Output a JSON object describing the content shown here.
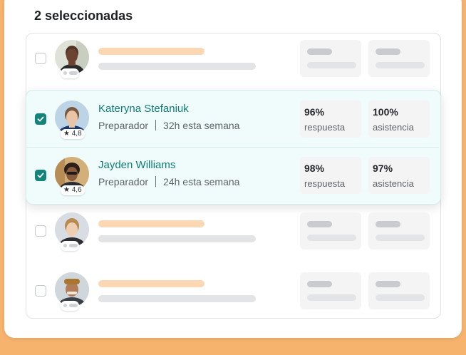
{
  "header": {
    "title": "2 seleccionadas"
  },
  "rows": [
    {
      "selected": false
    },
    {
      "selected": true,
      "name": "Kateryna Stefaniuk",
      "role": "Preparador",
      "hours": "32h esta semana",
      "rating": "4,8",
      "stat1": {
        "value": "96%",
        "label": "respuesta"
      },
      "stat2": {
        "value": "100%",
        "label": "asistencia"
      }
    },
    {
      "selected": true,
      "name": "Jayden Williams",
      "role": "Preparador",
      "hours": "24h esta semana",
      "rating": "4,6",
      "stat1": {
        "value": "98%",
        "label": "respuesta"
      },
      "stat2": {
        "value": "97%",
        "label": "asistencia"
      }
    },
    {
      "selected": false
    },
    {
      "selected": false
    }
  ],
  "colors": {
    "accent": "#12847a",
    "name": "#0f7d73",
    "background": "#f6b36e",
    "selected_bg": "#effcfb"
  },
  "icons": {
    "check": "check-icon",
    "star": "star-icon"
  }
}
